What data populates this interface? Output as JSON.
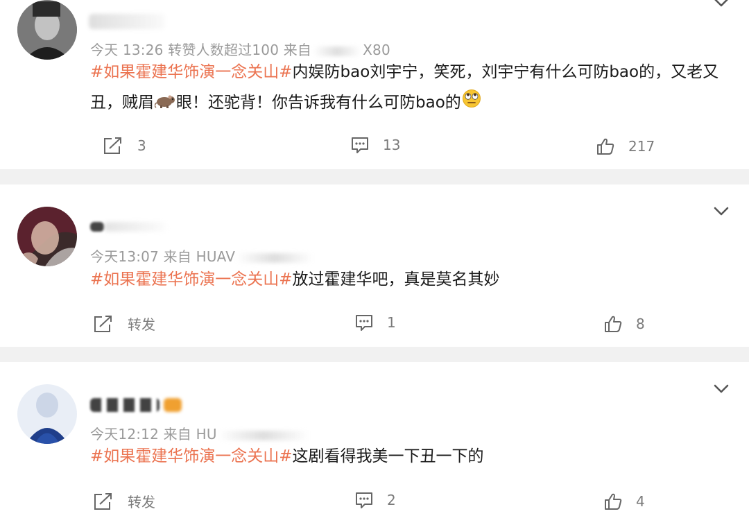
{
  "posts": [
    {
      "meta": {
        "time": "今天 13:26",
        "note": "转赞人数超过100",
        "from": "来自",
        "device_tail": "X80"
      },
      "text": {
        "hashtag": "#如果霍建华饰演一念关山#",
        "body": "内娱防bao刘宇宁，笑死，刘宇宁有什么可防bao的，又老又丑，贼眉",
        "body2": "眼！还驼背！你告诉我有什么可防bao的"
      },
      "actions": {
        "repost": "3",
        "comment": "13",
        "like": "217"
      }
    },
    {
      "meta": {
        "time": "今天13:07",
        "from": "来自",
        "device": "HUAV"
      },
      "text": {
        "hashtag": "#如果霍建华饰演一念关山#",
        "body": "放过霍建华吧，真是莫名其妙"
      },
      "actions": {
        "repost": "转发",
        "comment": "1",
        "like": "8"
      }
    },
    {
      "meta": {
        "time": "今天12:12",
        "from": "来自",
        "device": "HU"
      },
      "text": {
        "hashtag": "#如果霍建华饰演一念关山#",
        "body": "这剧看得我美一下丑一下的"
      },
      "actions": {
        "repost": "转发",
        "comment": "2",
        "like": "4"
      }
    }
  ],
  "icons": {
    "chevron": "chevron-down-icon",
    "repost": "repost-icon",
    "comment": "comment-icon",
    "like": "thumbs-up-icon",
    "rat": "rat-emoji",
    "eyeroll": "face-with-rolling-eyes-emoji"
  },
  "colors": {
    "hashtag": "#eb7350",
    "meta": "#9a9a9a",
    "action": "#7a7a7a",
    "separator": "#f1f1f1"
  }
}
